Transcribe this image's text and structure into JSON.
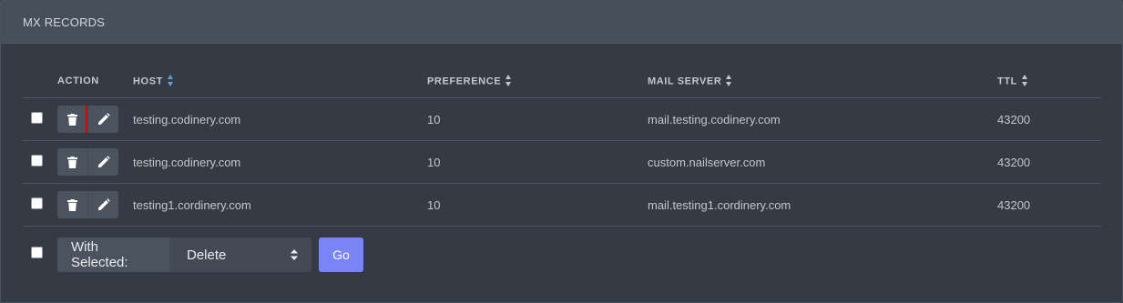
{
  "panel": {
    "title": "MX RECORDS"
  },
  "table": {
    "headers": {
      "action": "ACTION",
      "host": "HOST",
      "preference": "PREFERENCE",
      "mail_server": "MAIL SERVER",
      "ttl": "TTL"
    },
    "rows": [
      {
        "host": "testing.codinery.com",
        "preference": "10",
        "mail_server": "mail.testing.codinery.com",
        "ttl": "43200"
      },
      {
        "host": "testing.codinery.com",
        "preference": "10",
        "mail_server": "custom.nailserver.com",
        "ttl": "43200"
      },
      {
        "host": "testing1.cordinery.com",
        "preference": "10",
        "mail_server": "mail.testing1.cordinery.com",
        "ttl": "43200"
      }
    ]
  },
  "bulk": {
    "with_selected_label": "With Selected:",
    "action_value": "Delete",
    "go_label": "Go"
  },
  "icons": {
    "delete": "trash-icon",
    "edit": "pencil-icon",
    "sort": "sort-arrows-icon"
  },
  "colors": {
    "accent": "#7a84f5",
    "sort_active": "#5aa0e0",
    "highlight": "#e00000"
  }
}
